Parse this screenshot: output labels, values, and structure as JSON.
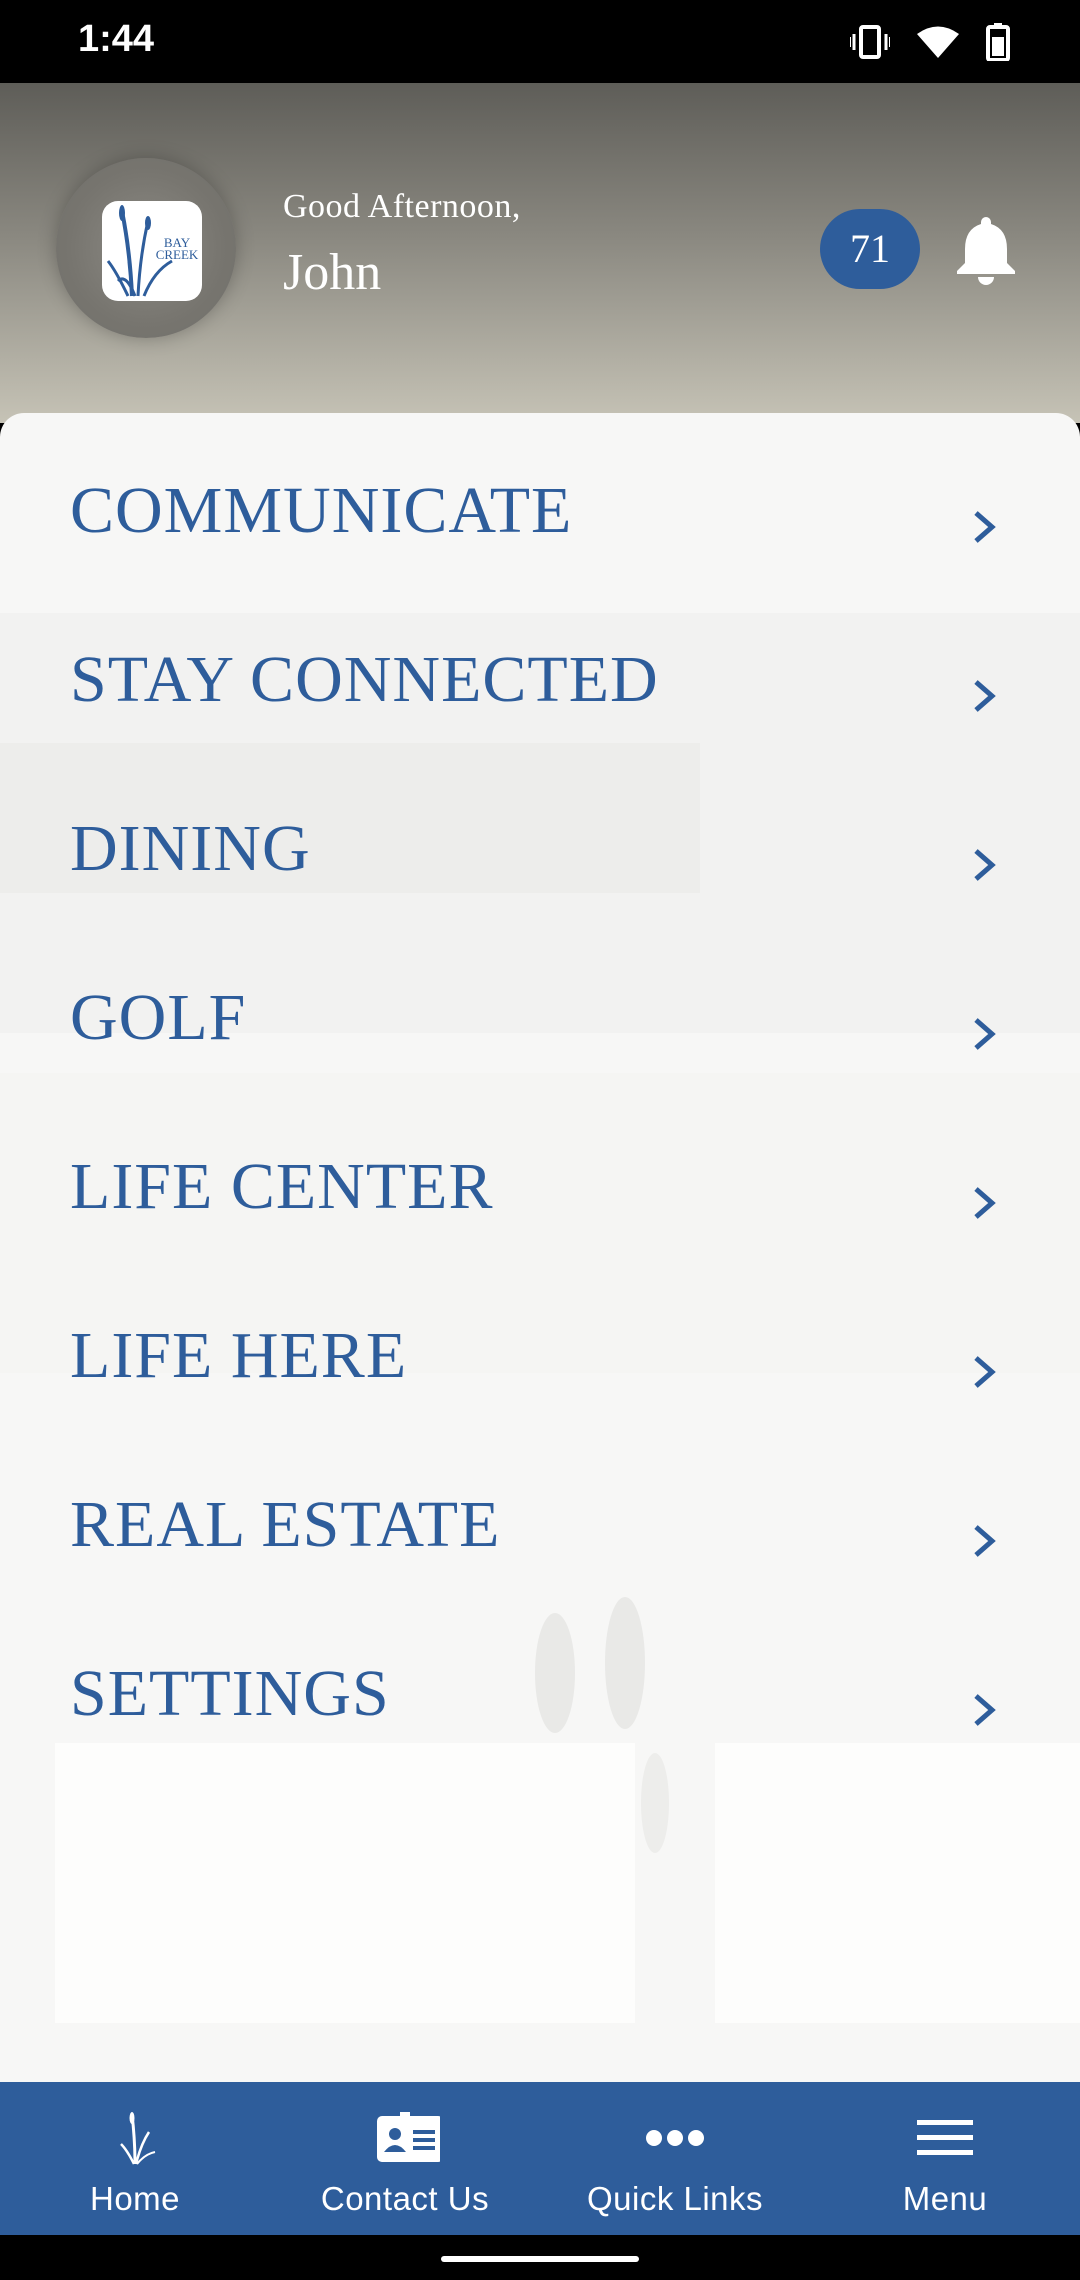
{
  "status_bar": {
    "time": "1:44",
    "icons": [
      "vibrate-icon",
      "wifi-icon",
      "battery-icon"
    ]
  },
  "header": {
    "logo_text": "BAY CREEK",
    "greeting": "Good Afternoon,",
    "user_name": "John",
    "notification_count": "71",
    "bell_icon": "bell-icon"
  },
  "menu": {
    "items": [
      {
        "label": "COMMUNICATE"
      },
      {
        "label": "STAY CONNECTED"
      },
      {
        "label": "DINING"
      },
      {
        "label": "GOLF"
      },
      {
        "label": "LIFE CENTER"
      },
      {
        "label": "LIFE HERE"
      },
      {
        "label": "REAL ESTATE"
      },
      {
        "label": "SETTINGS"
      }
    ],
    "chevron_icon": "chevron-right-icon"
  },
  "bottom_nav": {
    "items": [
      {
        "label": "Home",
        "icon": "reed-icon"
      },
      {
        "label": "Contact Us",
        "icon": "contact-card-icon"
      },
      {
        "label": "Quick Links",
        "icon": "more-dots-icon"
      },
      {
        "label": "Menu",
        "icon": "hamburger-icon"
      }
    ]
  },
  "colors": {
    "accent": "#2e5d9b",
    "panel": "#f7f7f6",
    "header_top": "#5e5d58",
    "header_bottom": "#c6c3b6"
  }
}
